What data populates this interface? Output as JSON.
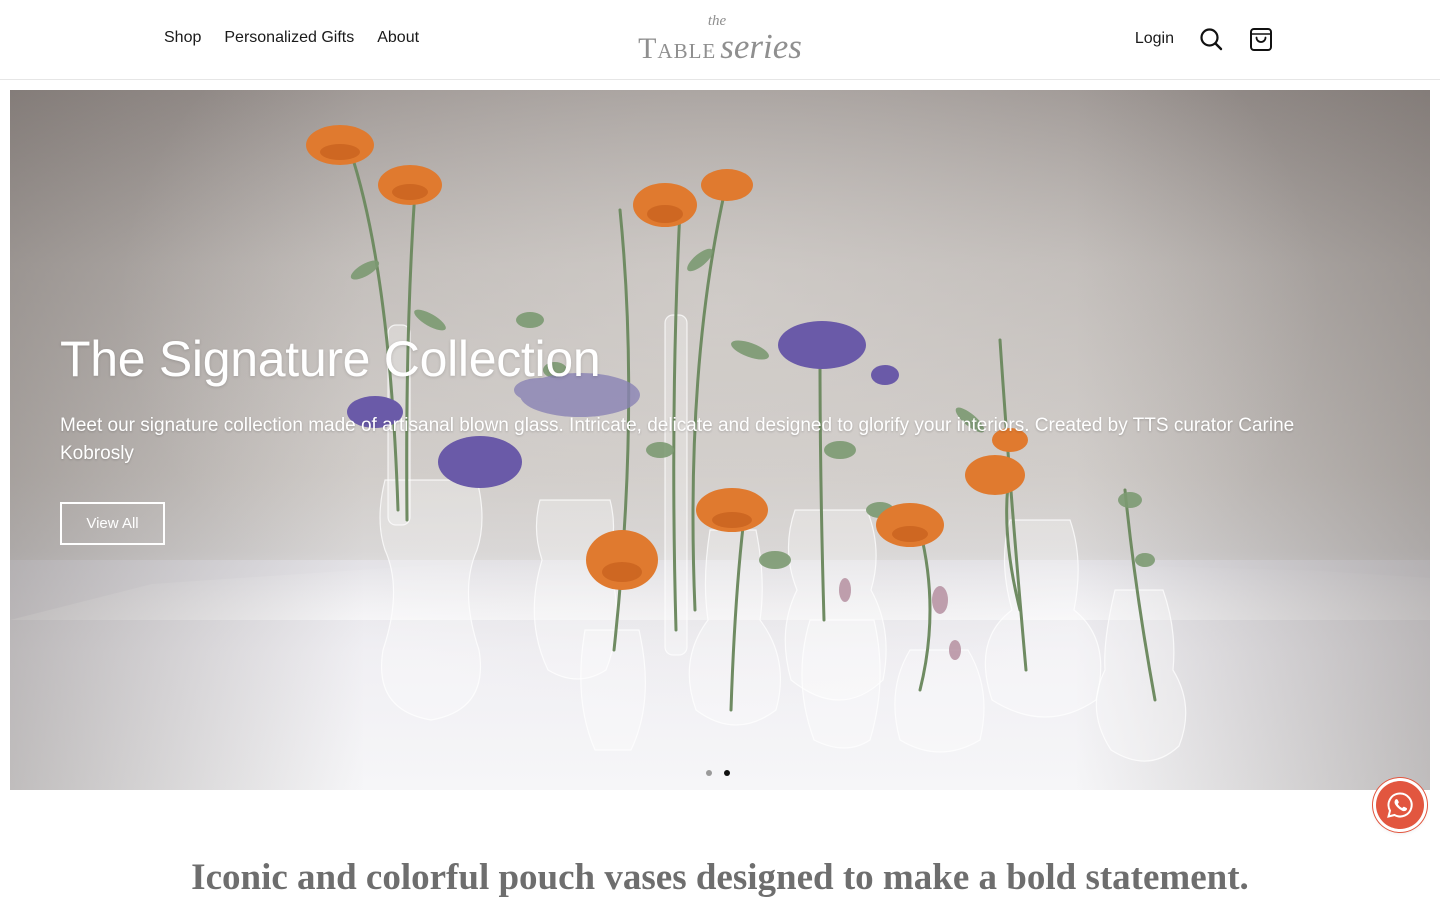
{
  "header": {
    "nav": [
      "Shop",
      "Personalized Gifts",
      "About"
    ],
    "logo": {
      "the": "the",
      "table": "Table",
      "series": "series"
    },
    "login_label": "Login",
    "icons": {
      "search": "search-icon",
      "cart": "cart-bag-icon"
    }
  },
  "hero": {
    "title": "The Signature Collection",
    "subtitle": "Meet our signature collection made of artisanal blown glass. Intricate, delicate and designed to glorify your interiors. Created by TTS curator Carine Kobrosly",
    "button_label": "View All",
    "slides": {
      "count": 2,
      "active": 2
    }
  },
  "floating": {
    "icon": "whatsapp-icon",
    "color": "#e2563f"
  },
  "tagline": "Iconic and colorful pouch vases designed to make a bold statement.",
  "colors": {
    "flower_orange": "#e07a2f",
    "flower_purple": "#6a5aa8",
    "leaf": "#6f8b62"
  }
}
